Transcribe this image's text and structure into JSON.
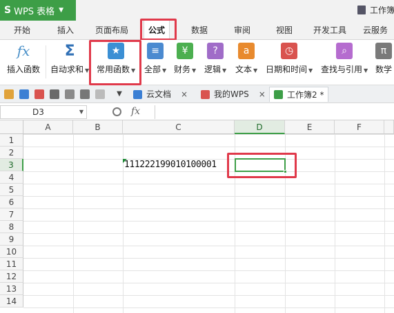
{
  "app": {
    "logo": "S",
    "name": "WPS 表格",
    "doc_title": "工作簿"
  },
  "ribbon_tabs": [
    "开始",
    "插入",
    "页面布局",
    "公式",
    "数据",
    "审阅",
    "视图",
    "开发工具",
    "云服务"
  ],
  "active_tab": "公式",
  "ribbon_buttons": [
    {
      "label": "插入函数",
      "icon": "fx-icon",
      "color": "#4a90c8",
      "dropdown": false
    },
    {
      "label": "自动求和",
      "icon": "sigma-icon",
      "color": "#2f6fb5",
      "dropdown": true
    },
    {
      "label": "常用函数",
      "icon": "star-book-icon",
      "color": "#3b8fd4",
      "dropdown": true
    },
    {
      "label": "全部",
      "icon": "list-book-icon",
      "color": "#4b8ad0",
      "dropdown": true
    },
    {
      "label": "财务",
      "icon": "money-book-icon",
      "color": "#4caf50",
      "dropdown": true
    },
    {
      "label": "逻辑",
      "icon": "question-book-icon",
      "color": "#a06cc8",
      "dropdown": true
    },
    {
      "label": "文本",
      "icon": "text-book-icon",
      "color": "#e88a2e",
      "dropdown": true
    },
    {
      "label": "日期和时间",
      "icon": "clock-book-icon",
      "color": "#d9534f",
      "dropdown": true
    },
    {
      "label": "查找与引用",
      "icon": "search-book-icon",
      "color": "#b56ccf",
      "dropdown": true
    },
    {
      "label": "数学",
      "icon": "math-book-icon",
      "color": "#7a7a7a",
      "dropdown": false
    }
  ],
  "doc_tabs": [
    {
      "label": "云文档",
      "icon": "cloud-doc-icon",
      "close": "×"
    },
    {
      "label": "我的WPS",
      "icon": "wps-logo-icon",
      "close": "×"
    },
    {
      "label": "工作簿2 *",
      "icon": "sheet-doc-icon",
      "close": ""
    }
  ],
  "formula_bar": {
    "cell_ref": "D3",
    "fx": "fx",
    "value": ""
  },
  "columns": [
    "A",
    "B",
    "C",
    "D",
    "E",
    "F"
  ],
  "rows": [
    "1",
    "2",
    "3",
    "4",
    "5",
    "6",
    "7",
    "8",
    "9",
    "10",
    "11",
    "12",
    "13",
    "14"
  ],
  "selected_column": "D",
  "selected_row": "3",
  "cells": {
    "C3": "111222199010100001"
  },
  "accent": "#3d9e47",
  "highlight": "#e0394a"
}
